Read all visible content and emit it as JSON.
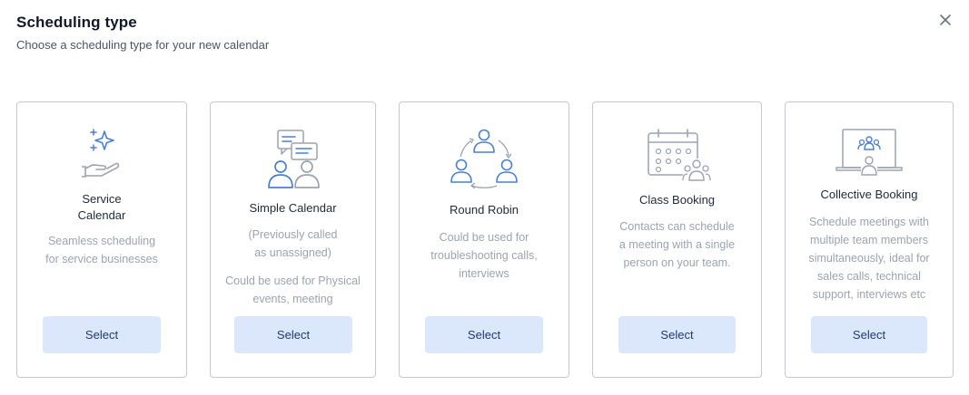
{
  "header": {
    "title": "Scheduling type",
    "subtitle": "Choose a scheduling type for your new calendar"
  },
  "cards": [
    {
      "icon": "sparkle-hand-icon",
      "title_lines": [
        "Service",
        "Calendar"
      ],
      "description": [
        "Seamless scheduling",
        "for service businesses"
      ],
      "button": "Select"
    },
    {
      "icon": "chat-users-icon",
      "title": "Simple Calendar",
      "description": [
        "(Previously called",
        "as unassigned)"
      ],
      "description2": [
        "Could be used for Physical",
        "events, meeting"
      ],
      "button": "Select"
    },
    {
      "icon": "round-robin-icon",
      "title": "Round Robin",
      "description": [
        "Could be used for",
        "troubleshooting calls,",
        "interviews"
      ],
      "button": "Select"
    },
    {
      "icon": "calendar-group-icon",
      "title": "Class Booking",
      "description": [
        "Contacts can schedule",
        "a meeting with a single",
        "person on your team."
      ],
      "button": "Select"
    },
    {
      "icon": "monitor-group-icon",
      "title": "Collective Booking",
      "description": [
        "Schedule meetings with",
        "multiple team members",
        "simultaneously, ideal for",
        "sales calls, technical",
        "support, interviews etc"
      ],
      "button": "Select"
    }
  ],
  "colors": {
    "accent_blue": "#4a7fd4",
    "icon_gray": "#9ca3af",
    "button_bg": "#dbe8fb",
    "button_text": "#1e3a6e"
  }
}
